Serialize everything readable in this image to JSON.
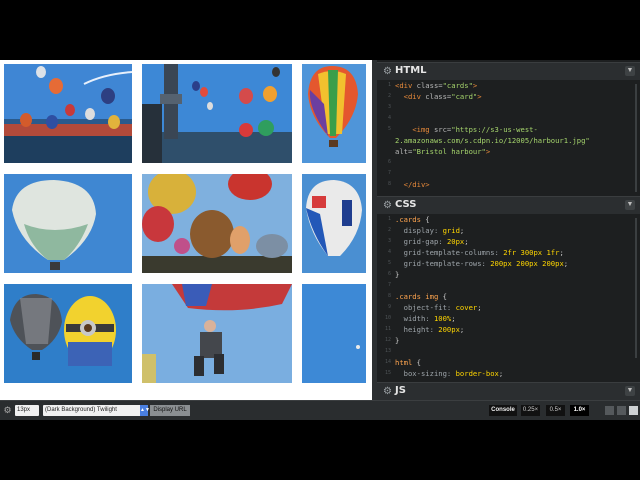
{
  "editors": {
    "html": {
      "title": "HTML",
      "lines": [
        {
          "n": "1",
          "parts": [
            [
              "tag",
              "<div "
            ],
            [
              "attr",
              "class="
            ],
            [
              "str",
              "\"cards\""
            ],
            [
              "tag",
              ">"
            ]
          ]
        },
        {
          "n": "2",
          "parts": [
            [
              "plain",
              "  "
            ],
            [
              "tag",
              "<div "
            ],
            [
              "attr",
              "class="
            ],
            [
              "str",
              "\"card\""
            ],
            [
              "tag",
              ">"
            ]
          ]
        },
        {
          "n": "3",
          "parts": []
        },
        {
          "n": "4",
          "parts": []
        },
        {
          "n": "5",
          "parts": [
            [
              "plain",
              "    "
            ],
            [
              "tag",
              "<img "
            ],
            [
              "attr",
              "src="
            ],
            [
              "str",
              "\"https://s3-us-west-"
            ]
          ]
        },
        {
          "n": "",
          "parts": [
            [
              "str",
              "2.amazonaws.com/s.cdpn.io/12005/harbour1.jpg\""
            ]
          ]
        },
        {
          "n": "",
          "parts": [
            [
              "attr",
              "alt="
            ],
            [
              "str",
              "\"Bristol harbour\""
            ],
            [
              "tag",
              ">"
            ]
          ]
        },
        {
          "n": "6",
          "parts": []
        },
        {
          "n": "7",
          "parts": []
        },
        {
          "n": "8",
          "parts": [
            [
              "plain",
              "  "
            ],
            [
              "tag",
              "</div>"
            ]
          ]
        }
      ]
    },
    "css": {
      "title": "CSS",
      "lines": [
        {
          "n": "1",
          "parts": [
            [
              "sel",
              ".cards "
            ],
            [
              "plain",
              "{"
            ]
          ]
        },
        {
          "n": "2",
          "parts": [
            [
              "prop",
              "  display: "
            ],
            [
              "val",
              "grid"
            ],
            [
              "plain",
              ";"
            ]
          ]
        },
        {
          "n": "3",
          "parts": [
            [
              "prop",
              "  grid-gap: "
            ],
            [
              "val",
              "20px"
            ],
            [
              "plain",
              ";"
            ]
          ]
        },
        {
          "n": "4",
          "parts": [
            [
              "prop",
              "  grid-template-columns: "
            ],
            [
              "val",
              "2fr 300px 1fr"
            ],
            [
              "plain",
              ";"
            ]
          ]
        },
        {
          "n": "5",
          "parts": [
            [
              "prop",
              "  grid-template-rows: "
            ],
            [
              "val",
              "200px 200px 200px"
            ],
            [
              "plain",
              ";"
            ]
          ]
        },
        {
          "n": "6",
          "parts": [
            [
              "plain",
              "}"
            ]
          ]
        },
        {
          "n": "7",
          "parts": []
        },
        {
          "n": "8",
          "parts": [
            [
              "sel",
              ".cards img "
            ],
            [
              "plain",
              "{"
            ]
          ]
        },
        {
          "n": "9",
          "parts": [
            [
              "prop",
              "  object-fit: "
            ],
            [
              "val",
              "cover"
            ],
            [
              "plain",
              ";"
            ]
          ]
        },
        {
          "n": "10",
          "parts": [
            [
              "prop",
              "  width: "
            ],
            [
              "val",
              "100%"
            ],
            [
              "plain",
              ";"
            ]
          ]
        },
        {
          "n": "11",
          "parts": [
            [
              "prop",
              "  height: "
            ],
            [
              "val",
              "200px"
            ],
            [
              "plain",
              ";"
            ]
          ]
        },
        {
          "n": "12",
          "parts": [
            [
              "plain",
              "}"
            ]
          ]
        },
        {
          "n": "13",
          "parts": []
        },
        {
          "n": "14",
          "parts": [
            [
              "sel",
              "html "
            ],
            [
              "plain",
              "{"
            ]
          ]
        },
        {
          "n": "15",
          "parts": [
            [
              "prop",
              "  box-sizing: "
            ],
            [
              "val",
              "border-box"
            ],
            [
              "plain",
              ";"
            ]
          ]
        }
      ]
    },
    "js": {
      "title": "JS"
    }
  },
  "bottom": {
    "font_size": "13px",
    "theme": "(Dark Background) Twilight",
    "display_url": "Display URL",
    "console": "Console",
    "zooms": [
      "0.25×",
      "0.5×",
      "1.0×"
    ]
  },
  "colors": {
    "sky": "#4d8fd1",
    "accent_selected": "#4a7fe0",
    "editor_bg": "#1d1f20"
  }
}
